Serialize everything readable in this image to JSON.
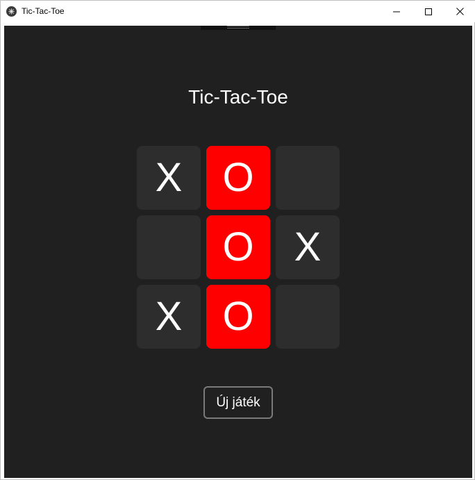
{
  "window": {
    "title": "Tic-Tac-Toe",
    "icon": "app-icon",
    "controls": [
      "minimize-icon",
      "maximize-icon",
      "close-icon"
    ]
  },
  "game": {
    "heading": "Tic-Tac-Toe",
    "board": [
      [
        "X",
        "O",
        ""
      ],
      [
        "",
        "O",
        "X"
      ],
      [
        "X",
        "O",
        ""
      ]
    ],
    "winning_cells": [
      [
        0,
        1
      ],
      [
        1,
        1
      ],
      [
        2,
        1
      ]
    ],
    "new_game_label": "Új játék"
  },
  "colors": {
    "background": "#202020",
    "cell": "#2d2d2d",
    "win_highlight": "#ff0000",
    "text": "#ffffff"
  }
}
